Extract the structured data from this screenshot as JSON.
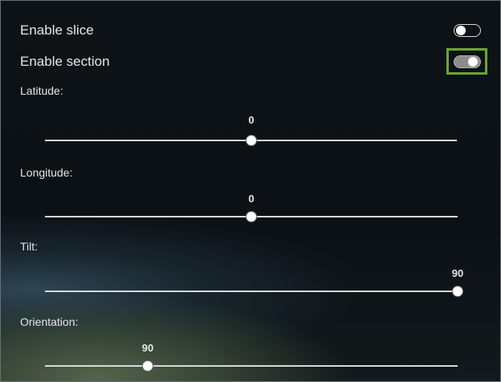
{
  "toggles": {
    "slice": {
      "label": "Enable slice",
      "state": "off"
    },
    "section": {
      "label": "Enable section",
      "state": "on"
    }
  },
  "sliders": {
    "latitude": {
      "label": "Latitude:",
      "value": "0",
      "position_fraction": 0.5
    },
    "longitude": {
      "label": "Longitude:",
      "value": "0",
      "position_fraction": 0.5
    },
    "tilt": {
      "label": "Tilt:",
      "value": "90",
      "position_fraction": 1.0
    },
    "orientation": {
      "label": "Orientation:",
      "value": "90",
      "position_fraction": 0.25
    }
  },
  "colors": {
    "highlight": "#6aa634",
    "text": "#e6e6e6",
    "track": "#d8d8d8"
  }
}
